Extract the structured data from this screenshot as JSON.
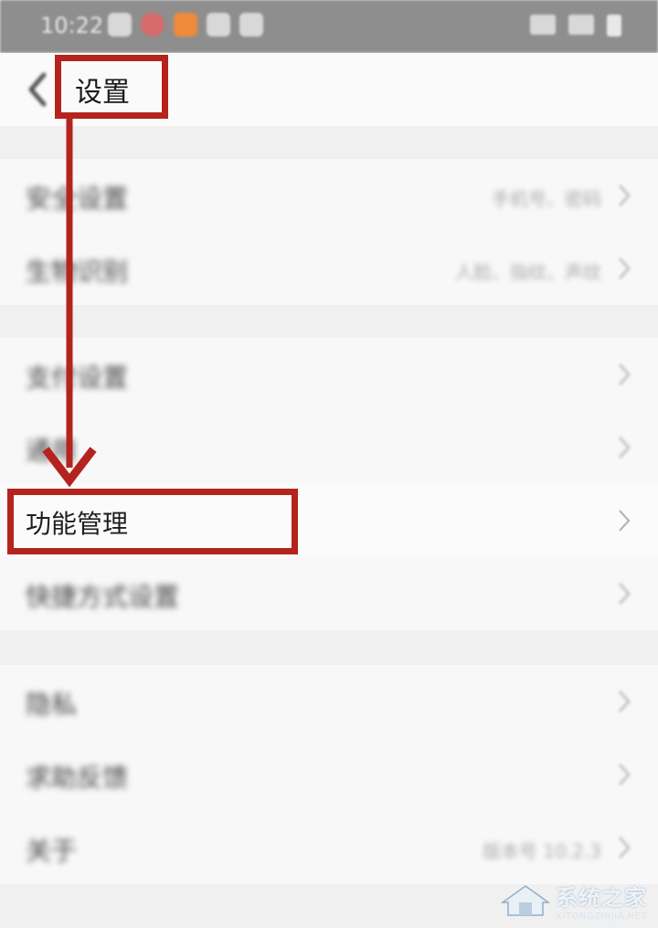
{
  "status_bar": {
    "time": "10:22"
  },
  "nav": {
    "title": "设置"
  },
  "groups": [
    {
      "items": [
        {
          "label": "安全设置",
          "value": "手机号、密码"
        },
        {
          "label": "生物识别",
          "value": "人脸、指纹、声纹"
        }
      ]
    },
    {
      "items": [
        {
          "label": "支付设置",
          "value": ""
        },
        {
          "label": "通用",
          "value": ""
        },
        {
          "label": "功能管理",
          "value": ""
        },
        {
          "label": "快捷方式设置",
          "value": ""
        }
      ]
    },
    {
      "items": [
        {
          "label": "隐私",
          "value": ""
        },
        {
          "label": "求助反馈",
          "value": ""
        },
        {
          "label": "关于",
          "value": "版本号 10.2.3"
        }
      ]
    }
  ],
  "annotation": {
    "color": "#b5231e"
  },
  "watermark": {
    "name": "系统之家",
    "url": "XITONGZHIJIA.NET"
  }
}
